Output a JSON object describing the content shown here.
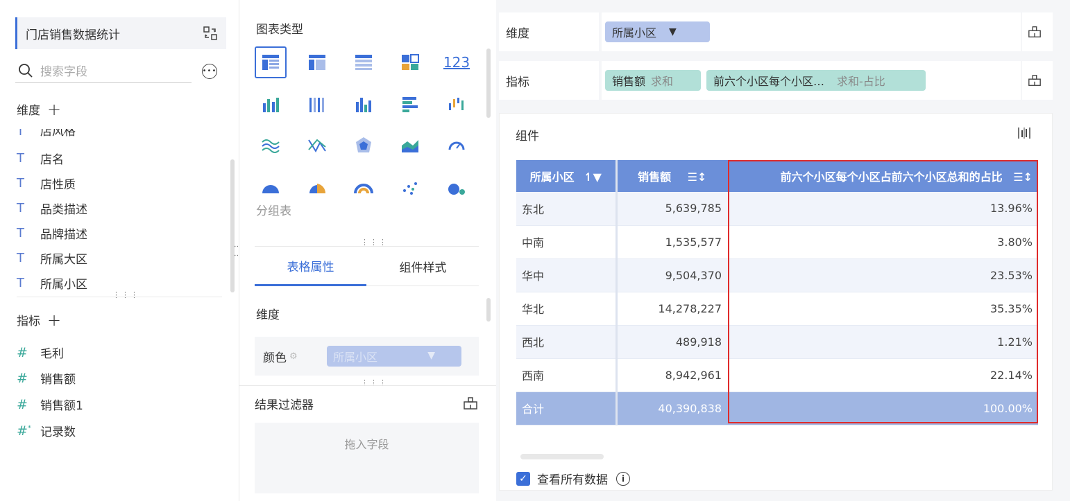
{
  "left": {
    "dataset_name": "门店销售数据统计",
    "search_placeholder": "搜索字段",
    "dimension_title": "维度",
    "dimension_fields": [
      "店风格",
      "店名",
      "店性质",
      "品类描述",
      "品牌描述",
      "所属大区",
      "所属小区"
    ],
    "measure_title": "指标",
    "measure_fields": [
      "毛利",
      "销售额",
      "销售额1",
      "记录数"
    ],
    "icons": {
      "switch": "swap-icon",
      "search": "search-icon",
      "more": "more-icon",
      "text_field": "text-type-icon",
      "number_field": "number-type-icon"
    }
  },
  "middle": {
    "chart_type_title": "图表类型",
    "selected_chart_label": "分组表",
    "tabs": [
      {
        "label": "表格属性",
        "active": true
      },
      {
        "label": "组件样式",
        "active": false
      }
    ],
    "dimension_label": "维度",
    "color_label": "颜色",
    "color_chip": "所属小区",
    "result_filter_title": "结果过滤器",
    "drop_hint": "拖入字段"
  },
  "right": {
    "dimension_row": {
      "label": "维度",
      "chip": "所属小区"
    },
    "measure_row": {
      "label": "指标",
      "chips": [
        {
          "name": "销售额",
          "agg": "求和"
        },
        {
          "name": "前六个小区每个小区…",
          "agg": "求和-占比"
        }
      ]
    },
    "component": {
      "title": "组件",
      "table": {
        "headers": [
          "所属小区",
          "销售额",
          "前六个小区每个小区占前六个小区总和的占比"
        ],
        "rows": [
          [
            "东北",
            "5,639,785",
            "13.96%"
          ],
          [
            "中南",
            "1,535,577",
            "3.80%"
          ],
          [
            "华中",
            "9,504,370",
            "23.53%"
          ],
          [
            "华北",
            "14,278,227",
            "35.35%"
          ],
          [
            "西北",
            "489,918",
            "1.21%"
          ],
          [
            "西南",
            "8,942,961",
            "22.14%"
          ]
        ],
        "total": [
          "合计",
          "40,390,838",
          "100.00%"
        ]
      },
      "view_all_label": "查看所有数据",
      "view_all_checked": true
    }
  },
  "colors": {
    "accent": "#3b6fd8",
    "header": "#6b8fd9",
    "total_row": "#a0b6e3",
    "highlight_border": "#e02b2b",
    "dim_chip": "#b6c6ec",
    "measure_chip": "#b2e0d8"
  }
}
